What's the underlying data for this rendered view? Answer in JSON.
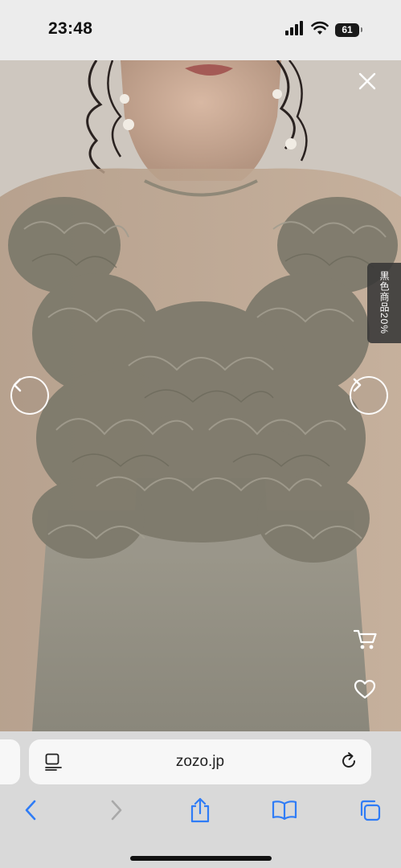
{
  "status_bar": {
    "time": "23:48",
    "battery": "61"
  },
  "product": {
    "side_tab_text": "黒色商品20%",
    "icons": {
      "close": "close-icon",
      "prev": "chevron-left-icon",
      "next": "chevron-right-icon",
      "cart": "cart-icon",
      "favorite": "heart-icon"
    }
  },
  "browser": {
    "url": "zozo.jp",
    "toolbar": [
      "back-icon",
      "forward-icon",
      "share-icon",
      "bookmarks-icon",
      "tabs-icon"
    ],
    "accent": "#2f7cf6"
  }
}
